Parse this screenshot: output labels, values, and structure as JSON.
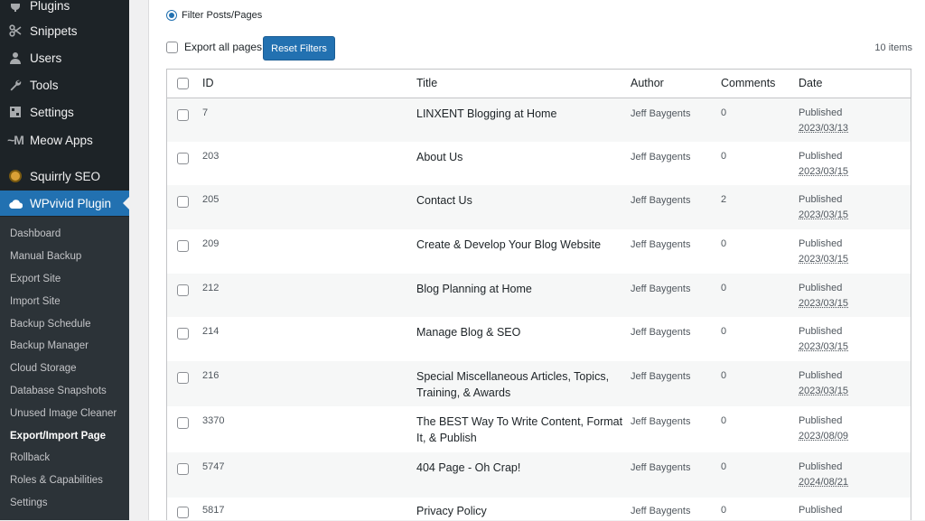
{
  "sidebar": {
    "menu": [
      {
        "label": "Plugins",
        "icon": "plugin-icon"
      },
      {
        "label": "Snippets",
        "icon": "scissors-icon"
      },
      {
        "label": "Users",
        "icon": "users-icon"
      },
      {
        "label": "Tools",
        "icon": "wrench-icon"
      },
      {
        "label": "Settings",
        "icon": "settings-icon"
      },
      {
        "label": "Meow Apps",
        "icon": "meow-icon"
      },
      {
        "label": "Squirrly SEO",
        "icon": "squirrly-icon"
      },
      {
        "label": "WPvivid Plugin",
        "icon": "cloud-icon"
      }
    ],
    "submenu": [
      "Dashboard",
      "Manual Backup",
      "Export Site",
      "Import Site",
      "Backup Schedule",
      "Backup Manager",
      "Cloud Storage",
      "Database Snapshots",
      "Unused Image Cleaner",
      "Export/Import Page",
      "Rollback",
      "Roles & Capabilities",
      "Settings"
    ],
    "current_submenu": "Export/Import Page"
  },
  "filter": {
    "radio_label": "Filter Posts/Pages",
    "export_all_label": "Export all pages",
    "reset_button": "Reset Filters",
    "items_count": "10 items"
  },
  "table": {
    "headers": {
      "id": "ID",
      "title": "Title",
      "author": "Author",
      "comments": "Comments",
      "date": "Date"
    },
    "rows": [
      {
        "id": "7",
        "title": "LINXENT Blogging at Home",
        "author": "Jeff Baygents",
        "comments": "0",
        "status": "Published",
        "date": "2023/03/13"
      },
      {
        "id": "203",
        "title": "About Us",
        "author": "Jeff Baygents",
        "comments": "0",
        "status": "Published",
        "date": "2023/03/15"
      },
      {
        "id": "205",
        "title": "Contact Us",
        "author": "Jeff Baygents",
        "comments": "2",
        "status": "Published",
        "date": "2023/03/15"
      },
      {
        "id": "209",
        "title": "Create & Develop Your Blog Website",
        "author": "Jeff Baygents",
        "comments": "0",
        "status": "Published",
        "date": "2023/03/15"
      },
      {
        "id": "212",
        "title": "Blog Planning at Home",
        "author": "Jeff Baygents",
        "comments": "0",
        "status": "Published",
        "date": "2023/03/15"
      },
      {
        "id": "214",
        "title": "Manage Blog & SEO",
        "author": "Jeff Baygents",
        "comments": "0",
        "status": "Published",
        "date": "2023/03/15"
      },
      {
        "id": "216",
        "title": "Special Miscellaneous Articles, Topics, Training, & Awards",
        "author": "Jeff Baygents",
        "comments": "0",
        "status": "Published",
        "date": "2023/03/15"
      },
      {
        "id": "3370",
        "title": "The BEST Way To Write Content, Format It, & Publish",
        "author": "Jeff Baygents",
        "comments": "0",
        "status": "Published",
        "date": "2023/08/09"
      },
      {
        "id": "5747",
        "title": "404 Page - Oh Crap!",
        "author": "Jeff Baygents",
        "comments": "0",
        "status": "Published",
        "date": "2024/08/21"
      },
      {
        "id": "5817",
        "title": "Privacy Policy",
        "author": "Jeff Baygents",
        "comments": "0",
        "status": "Published",
        "date": ""
      }
    ]
  },
  "colors": {
    "accent": "#2271b1",
    "sidebar_bg": "#1d2327",
    "submenu_bg": "#2c3338"
  }
}
